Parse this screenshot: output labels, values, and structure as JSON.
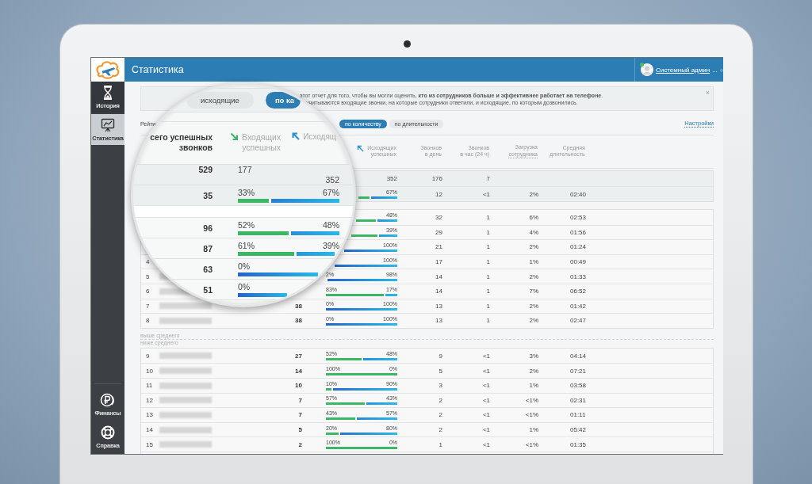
{
  "header": {
    "title": "Статистика",
    "user": "Системный админ",
    "user_suffix": "...",
    "online": true
  },
  "sidebar": {
    "top_items": [
      {
        "label": "История",
        "selected": false
      },
      {
        "label": "Статистика",
        "selected": true
      }
    ],
    "bottom_items": [
      {
        "label": "Финансы",
        "selected": false
      },
      {
        "label": "Справка",
        "selected": false
      }
    ]
  },
  "notice": {
    "line_1": "этот отчет для того, чтобы вы могли оценить, **кто из сотрудников больше и эффективнее работает на телефоне**.",
    "line_2": "учитываются входящие звонки, на которые сотрудники ответили, и исходящие, по которым дозвонились.",
    "close": "×"
  },
  "filters": {
    "label": "Рейти",
    "options": [
      {
        "label": "по количеству",
        "selected": true
      },
      {
        "label": "по длительности",
        "selected": false
      }
    ],
    "settings": "Настройки"
  },
  "table": {
    "columns": {
      "outgoing": [
        "Исходящих",
        "успешных"
      ],
      "per_day": [
        "Звонков",
        "в день"
      ],
      "per_hour": [
        "Звонков",
        "в час (24 ч)"
      ],
      "load": [
        "Загрузка",
        "сотрудника"
      ],
      "avg": [
        "Средняя",
        "длительность"
      ]
    },
    "summary": [
      {
        "out_count": "352",
        "per_day": "176",
        "per_hour": "7"
      },
      {
        "out": "67%",
        "level": 0.33,
        "per_day": "12",
        "per_hour": "<1",
        "load": "2%",
        "avg": "02:40"
      }
    ],
    "groups": [
      {
        "rows": [
          {
            "blurred_name": false,
            "out": "48%",
            "level": 0.52,
            "per_day": "32",
            "per_hour": "1",
            "load": "6%",
            "avg": "02:53"
          },
          {
            "blurred_name": false,
            "out": "39%",
            "level": 0.61,
            "per_day": "29",
            "per_hour": "1",
            "load": "4%",
            "avg": "01:56"
          },
          {
            "blurred_name": false,
            "out": "100%",
            "level": 0,
            "per_day": "21",
            "per_hour": "1",
            "load": "2%",
            "avg": "01:24"
          },
          {
            "number": "4",
            "blurred_name": false,
            "out": "100%",
            "level": 0,
            "per_day": "17",
            "per_hour": "1",
            "load": "1%",
            "avg": "00:49"
          },
          {
            "number": "5",
            "blurred_name": true,
            "in": "2%",
            "out": "98%",
            "level": 0.02,
            "per_day": "14",
            "per_hour": "1",
            "load": "2%",
            "avg": "01:33"
          },
          {
            "number": "6",
            "blurred_name": true,
            "in": "83%",
            "out": "17%",
            "level": 0.83,
            "per_day": "14",
            "per_hour": "1",
            "load": "7%",
            "avg": "06:52"
          },
          {
            "number": "7",
            "blurred_name": true,
            "total": "38",
            "in": "0%",
            "out": "100%",
            "level": 0,
            "per_day": "13",
            "per_hour": "1",
            "load": "2%",
            "avg": "01:42"
          },
          {
            "number": "8",
            "blurred_name": true,
            "total": "38",
            "in": "0%",
            "out": "100%",
            "level": 0,
            "per_day": "13",
            "per_hour": "1",
            "load": "2%",
            "avg": "02:47"
          }
        ]
      },
      {
        "rows": [
          {
            "number": "9",
            "blurred_name": true,
            "total": "27",
            "in": "52%",
            "out": "48%",
            "level": 0.52,
            "per_day": "9",
            "per_hour": "<1",
            "load": "3%",
            "avg": "04:14"
          },
          {
            "number": "10",
            "blurred_name": true,
            "total": "14",
            "in": "100%",
            "out": "0%",
            "level": 1,
            "per_day": "5",
            "per_hour": "<1",
            "load": "2%",
            "avg": "07:21"
          },
          {
            "number": "11",
            "blurred_name": true,
            "total": "10",
            "in": "10%",
            "out": "90%",
            "level": 0.1,
            "per_day": "3",
            "per_hour": "<1",
            "load": "1%",
            "avg": "03:58"
          },
          {
            "number": "12",
            "blurred_name": true,
            "total": "7",
            "in": "57%",
            "out": "43%",
            "level": 0.57,
            "per_day": "2",
            "per_hour": "<1",
            "load": "<1%",
            "avg": "02:31"
          },
          {
            "number": "13",
            "blurred_name": true,
            "total": "7",
            "in": "43%",
            "out": "57%",
            "level": 0.43,
            "per_day": "2",
            "per_hour": "<1",
            "load": "<1%",
            "avg": "01:11"
          },
          {
            "number": "14",
            "blurred_name": true,
            "total": "5",
            "in": "20%",
            "out": "80%",
            "level": 0.2,
            "per_day": "2",
            "per_hour": "<1",
            "load": "1%",
            "avg": "05:42"
          },
          {
            "number": "15",
            "blurred_name": true,
            "total": "2",
            "in": "100%",
            "out": "0%",
            "level": 1,
            "per_day": "1",
            "per_hour": "<1",
            "load": "<1%",
            "avg": "01:35"
          }
        ]
      }
    ],
    "divider_labels": [
      "выше среднего",
      "ниже среднего"
    ]
  },
  "lens": {
    "tabs": [
      {
        "label": "исходящие",
        "selected": false
      },
      {
        "label": "по ка",
        "selected": true
      }
    ],
    "columns": {
      "total": [
        "сего успешных",
        "звонков"
      ],
      "incoming": [
        "Входящих",
        "успешных"
      ],
      "outgoing": [
        "Исходящ"
      ]
    },
    "rows": [
      {
        "kind": "counts",
        "total": "529",
        "in": "177",
        "out": "352"
      },
      {
        "kind": "share",
        "total": "35",
        "in": "33%",
        "out": "67%",
        "level": 0.33
      },
      {
        "kind": "blank"
      },
      {
        "kind": "share",
        "total": "96",
        "in": "52%",
        "out": "48%",
        "level": 0.52
      },
      {
        "kind": "share",
        "total": "87",
        "in": "61%",
        "out": "39%",
        "level": 0.61
      },
      {
        "kind": "share",
        "total": "63",
        "in": "0%",
        "level": 0
      },
      {
        "kind": "share",
        "total": "51",
        "in": "0%",
        "level": 0
      }
    ]
  }
}
